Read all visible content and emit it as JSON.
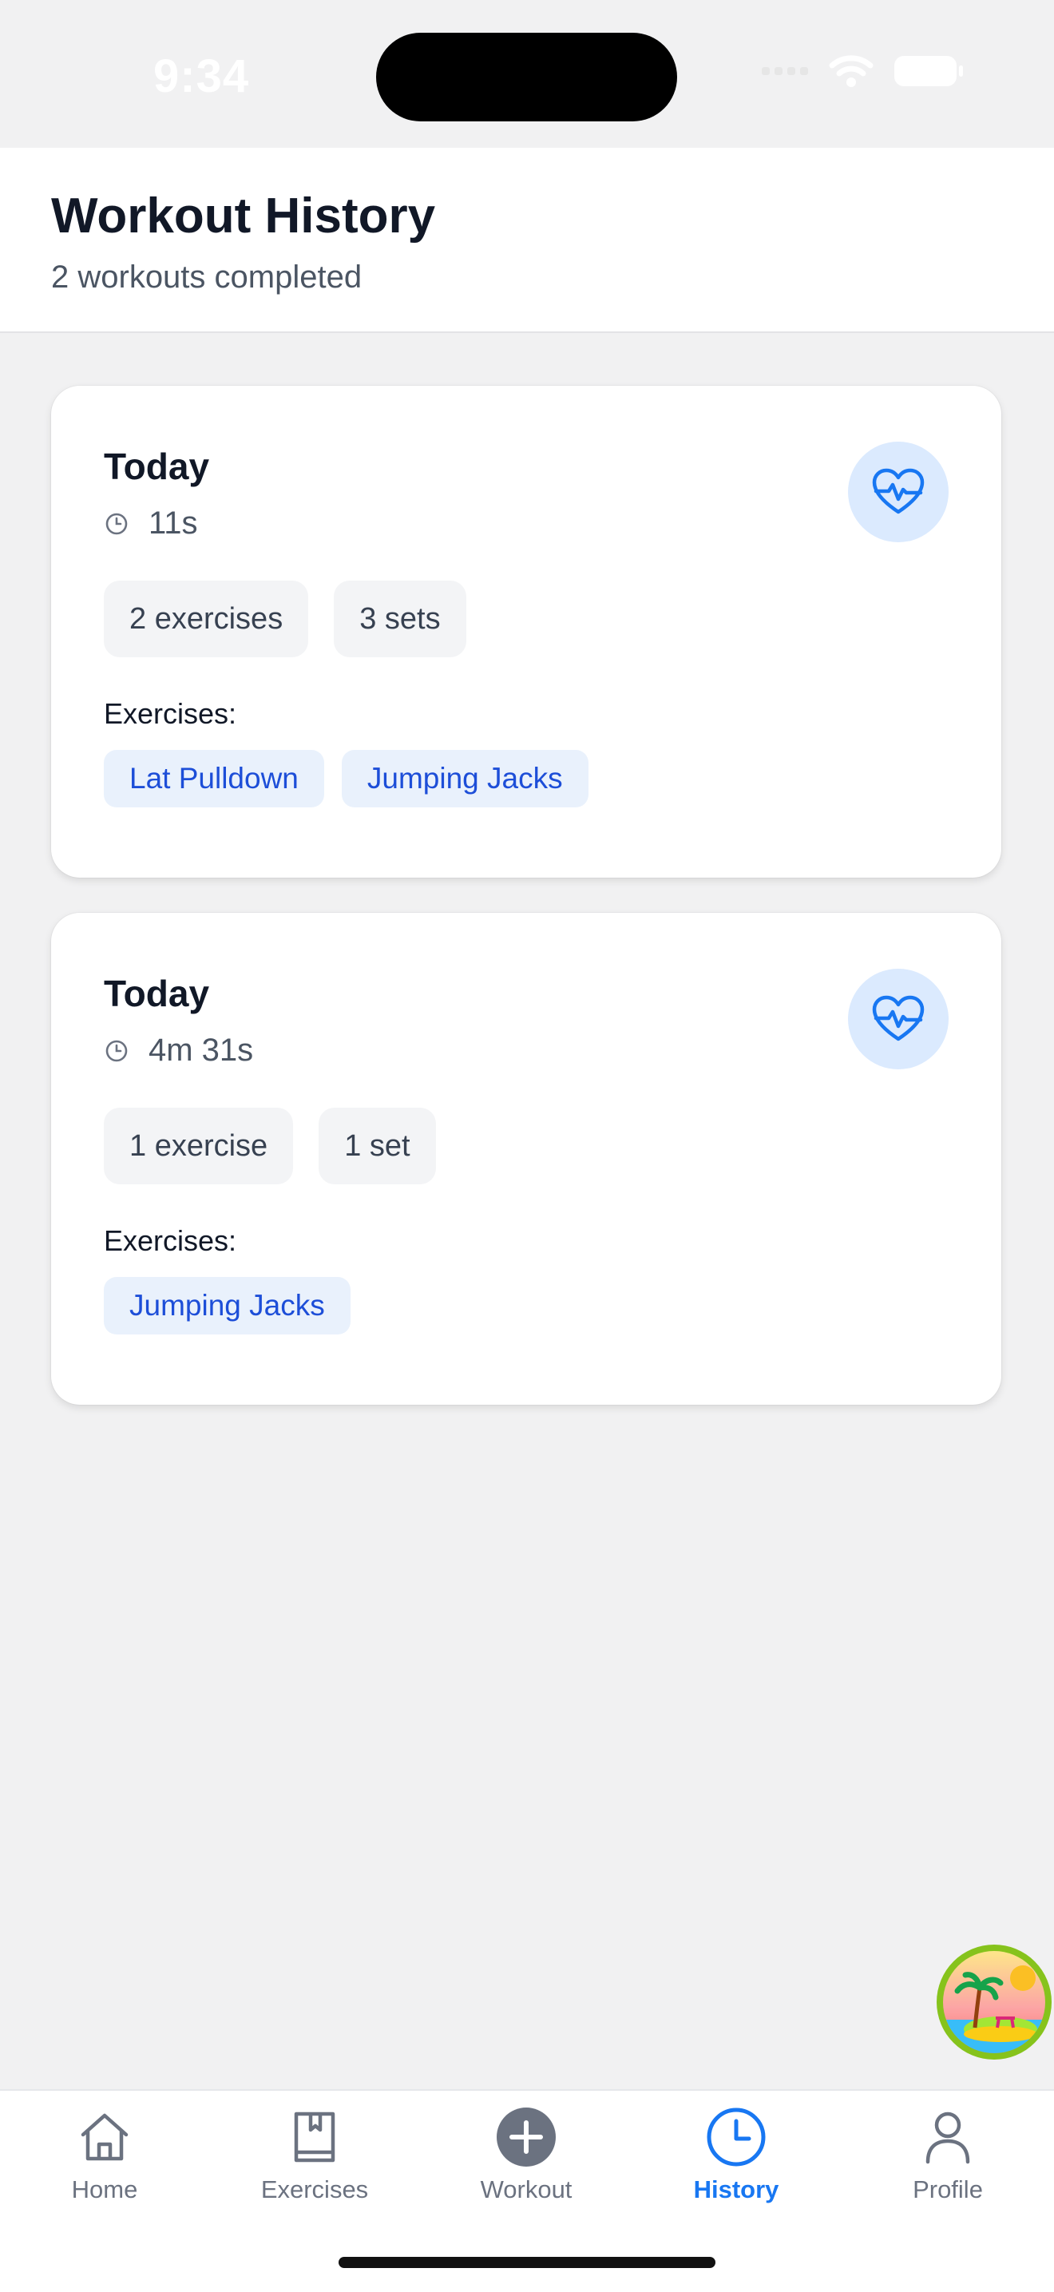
{
  "status_bar": {
    "time": "9:34"
  },
  "header": {
    "title": "Workout History",
    "subtitle": "2 workouts completed"
  },
  "workouts": [
    {
      "date": "Today",
      "duration": "11s",
      "exercise_count": "2 exercises",
      "set_count": "3 sets",
      "exercises_label": "Exercises:",
      "exercises": [
        "Lat Pulldown",
        "Jumping Jacks"
      ]
    },
    {
      "date": "Today",
      "duration": "4m 31s",
      "exercise_count": "1 exercise",
      "set_count": "1 set",
      "exercises_label": "Exercises:",
      "exercises": [
        "Jumping Jacks"
      ]
    }
  ],
  "tabs": [
    {
      "label": "Home",
      "icon": "home-icon",
      "active": false
    },
    {
      "label": "Exercises",
      "icon": "book-icon",
      "active": false
    },
    {
      "label": "Workout",
      "icon": "plus-circle-icon",
      "active": false
    },
    {
      "label": "History",
      "icon": "clock-icon",
      "active": true
    },
    {
      "label": "Profile",
      "icon": "person-icon",
      "active": false
    }
  ],
  "colors": {
    "accent": "#1877f2",
    "tag_text": "#1d4ed8",
    "tag_bg": "#e9f1fc",
    "heart_bg": "#dbeafe"
  }
}
